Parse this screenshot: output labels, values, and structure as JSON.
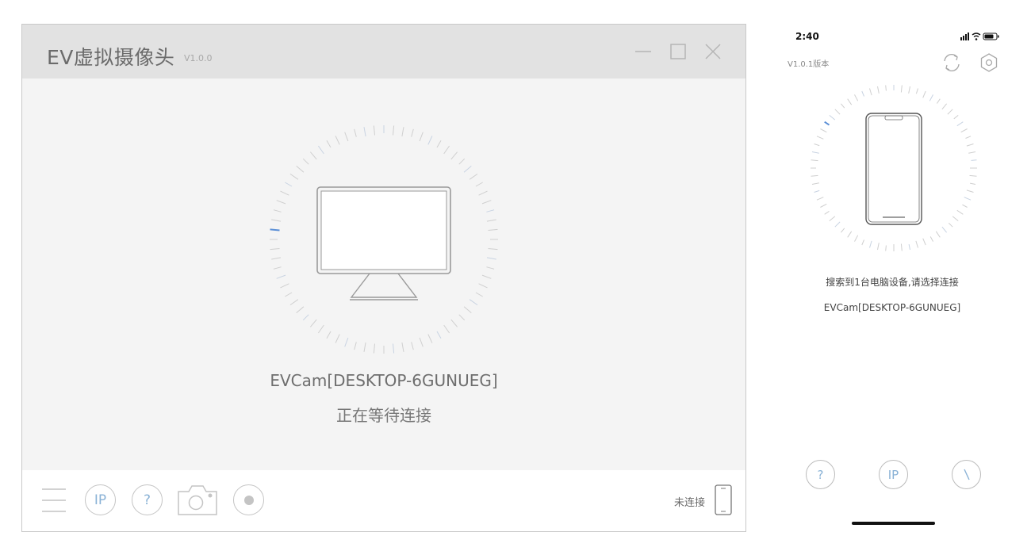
{
  "window": {
    "title": "EV虚拟摄像头",
    "version": "V1.0.0"
  },
  "main": {
    "device_name": "EVCam[DESKTOP-6GUNUEG]",
    "status": "正在等待连接"
  },
  "footer": {
    "ip_label": "IP",
    "help_label": "?",
    "connection_status": "未连接"
  },
  "phone": {
    "time": "2:40",
    "version": "V1.0.1版本",
    "search_result": "搜索到1台电脑设备,请选择连接",
    "device_name": "EVCam[DESKTOP-6GUNUEG]",
    "help_label": "?",
    "ip_label": "IP"
  },
  "colors": {
    "accent": "#5b8fd6",
    "titlebar": "#e2e2e2",
    "body": "#f4f4f4"
  }
}
